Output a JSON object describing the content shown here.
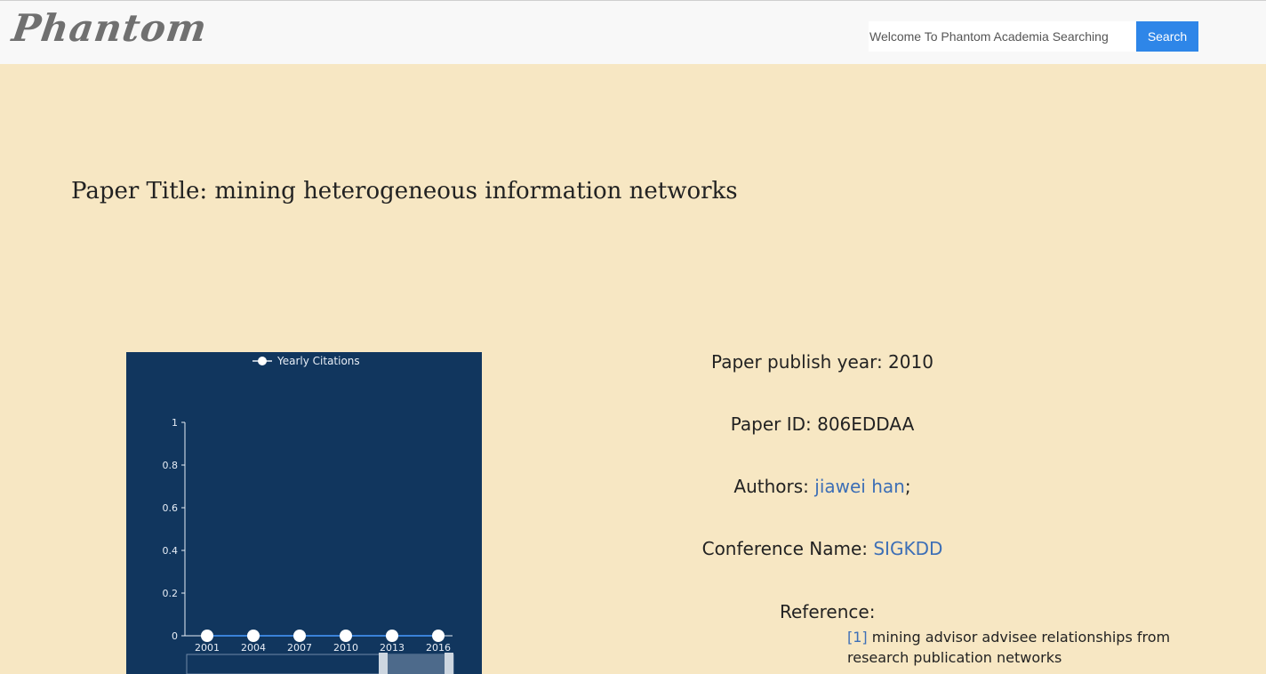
{
  "header": {
    "logo": "Phantom",
    "search": {
      "placeholder": "Welcome To Phantom Academia Searching",
      "button_label": "Search"
    }
  },
  "paper": {
    "title": "Paper Title: mining heterogeneous information networks",
    "year_label": "Paper publish year: 2010",
    "id_label": "Paper ID: 806EDDAA",
    "authors_label": "Authors:",
    "authors": [
      "jiawei han"
    ],
    "author_separator": ";",
    "conference_label": "Conference Name:",
    "conference": "SIGKDD",
    "reference_label": "Reference:",
    "references": [
      {
        "index": "[1]",
        "title": "mining advisor advisee relationships from research publication networks"
      }
    ]
  },
  "chart_data": {
    "type": "line",
    "legend": [
      "Yearly Citations"
    ],
    "legend_position": "top",
    "background": "#11365e",
    "series": [
      {
        "name": "Yearly Citations",
        "x": [
          2001,
          2004,
          2007,
          2010,
          2013,
          2016
        ],
        "values": [
          0,
          0,
          0,
          0,
          0,
          0
        ]
      }
    ],
    "x_ticks": [
      "2001",
      "2004",
      "2007",
      "2010",
      "2013",
      "2016"
    ],
    "y_ticks": [
      "0",
      "0.2",
      "0.4",
      "0.6",
      "0.8",
      "1"
    ],
    "ylim": [
      0,
      1
    ],
    "grid": false,
    "data_zoom": true
  }
}
